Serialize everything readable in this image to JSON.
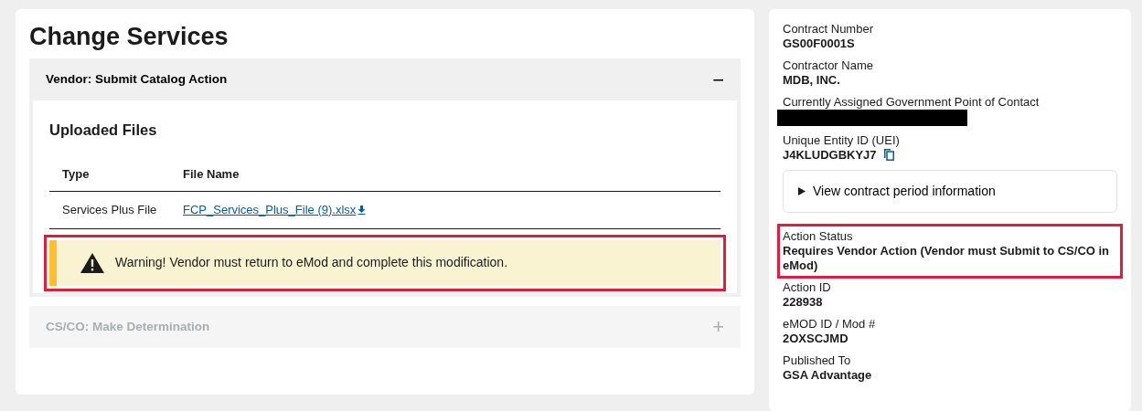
{
  "page_title": "Change Services",
  "accordion": [
    {
      "title": "Vendor: Submit Catalog Action",
      "expanded": true,
      "disabled": false,
      "toggle": "−",
      "section_title": "Uploaded Files",
      "table": {
        "columns": [
          "Type",
          "File Name"
        ],
        "rows": [
          {
            "type": "Services Plus File",
            "file_name": "FCP_Services_Plus_File (9).xlsx"
          }
        ]
      },
      "alert": {
        "text": "Warning! Vendor must return to eMod and complete this modification.",
        "highlighted": true
      }
    },
    {
      "title": "CS/CO: Make Determination",
      "expanded": false,
      "disabled": true,
      "toggle": "+"
    }
  ],
  "details": [
    {
      "kind": "field",
      "label": "Contract Number",
      "value": "GS00F0001S"
    },
    {
      "kind": "field",
      "label": "Contractor Name",
      "value": "MDB, INC."
    },
    {
      "kind": "field",
      "label": "Currently Assigned Government Point of Contact",
      "redacted": true
    },
    {
      "kind": "field",
      "label": "Unique Entity ID (UEI)",
      "value": "J4KLUDGBKYJ7",
      "copyable": true
    },
    {
      "kind": "disclosure",
      "label": "View contract period information",
      "expanded": false
    },
    {
      "kind": "field",
      "label": "Action Status",
      "value": "Requires Vendor Action (Vendor must Submit to CS/CO in eMod)",
      "highlighted": true
    },
    {
      "kind": "field",
      "label": "Action ID",
      "value": "228938"
    },
    {
      "kind": "field",
      "label": "eMOD ID / Mod #",
      "value": "2OXSCJMD"
    },
    {
      "kind": "field",
      "label": "Published To",
      "value": "GSA Advantage"
    }
  ]
}
